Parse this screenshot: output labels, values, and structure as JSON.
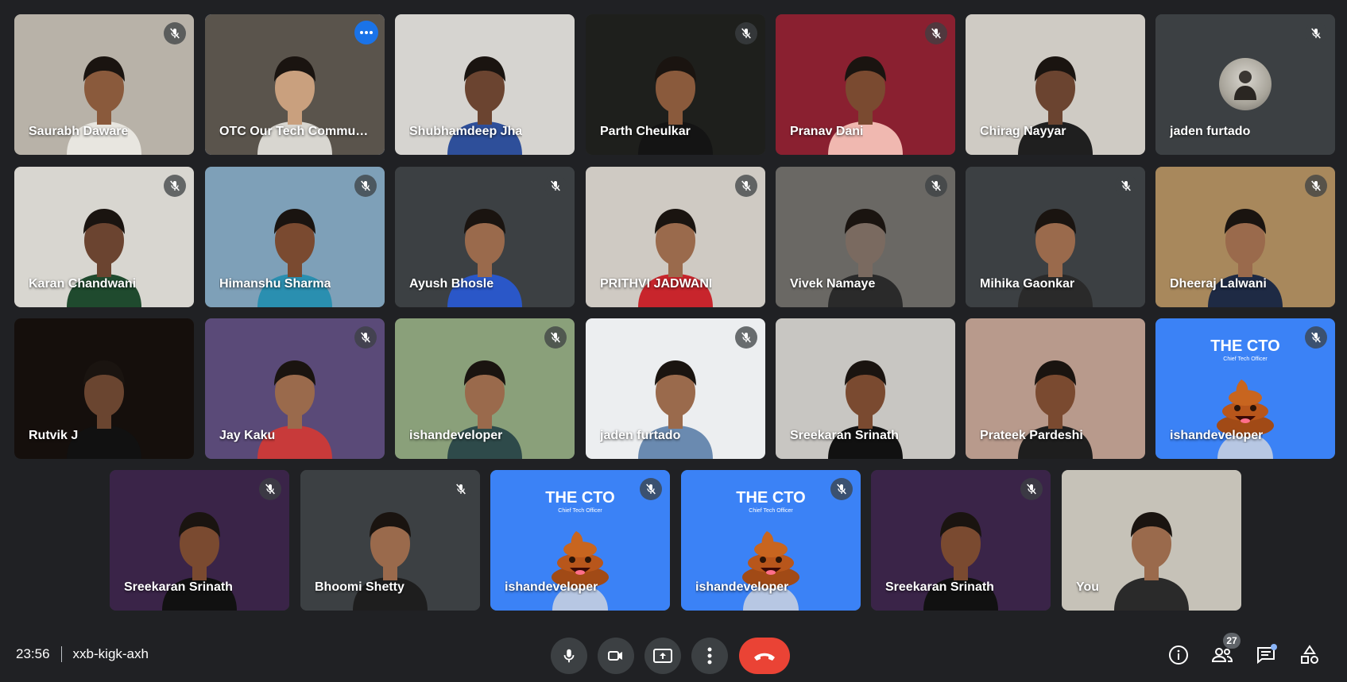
{
  "meeting": {
    "time": "23:56",
    "code": "xxb-kigk-axh"
  },
  "participant_count": "27",
  "colors": {
    "background": "#202124",
    "tile": "#3c4043",
    "accent": "#1a73e8",
    "active_outline": "#8ab4f8",
    "end_call": "#ea4335"
  },
  "cto_card": {
    "title": "THE CTO",
    "subtitle": "Chief Tech Officer"
  },
  "tiles": [
    {
      "name": "Saurabh Daware",
      "muted": true,
      "bg": "#b8b2a8",
      "skin": "#8a5a3c",
      "shirt": "#e8e6e0"
    },
    {
      "name": "OTC Our Tech Community",
      "muted": false,
      "more": true,
      "active": true,
      "bg": "#5a544c",
      "skin": "#c9a07e",
      "shirt": "#d8d6d0"
    },
    {
      "name": "Shubhamdeep Jha",
      "muted": false,
      "bg": "#d6d4d0",
      "skin": "#6b4430",
      "shirt": "#2e4f9a"
    },
    {
      "name": "Parth Cheulkar",
      "muted": true,
      "bg": "#1e1f1c",
      "skin": "#8a5a3c",
      "shirt": "#141414"
    },
    {
      "name": "Pranav Dani",
      "muted": true,
      "bg": "#8a2030",
      "skin": "#7a4a30",
      "shirt": "#f0b8b0"
    },
    {
      "name": "Chirag Nayyar",
      "muted": false,
      "bg": "#cfcbc4",
      "skin": "#6b4430",
      "shirt": "#1f1f1f"
    },
    {
      "name": "jaden furtado",
      "muted": true,
      "avatar": true,
      "bg": "#3c4043"
    },
    {
      "name": "Karan Chandwani",
      "muted": true,
      "bg": "#d8d6d0",
      "skin": "#6b4430",
      "shirt": "#1f4a2e"
    },
    {
      "name": "Himanshu Sharma",
      "muted": true,
      "bg": "#7ea0b8",
      "skin": "#7a4a30",
      "shirt": "#2a8fb0"
    },
    {
      "name": "Ayush Bhosle",
      "muted": true,
      "bg": "#3c4043",
      "skin": "#9a6a4c",
      "shirt": "#2a57c8"
    },
    {
      "name": "PRITHVI JADWANI",
      "muted": true,
      "bg": "#cfcac3",
      "skin": "#9a6a4c",
      "shirt": "#c8252c"
    },
    {
      "name": "Vivek Namaye",
      "muted": true,
      "bg": "#6a6864",
      "skin": "#7a6a60",
      "shirt": "#2a2a2a"
    },
    {
      "name": "Mihika Gaonkar",
      "muted": true,
      "bg": "#3c4043",
      "skin": "#9a6a4c",
      "shirt": "#2a2a2a"
    },
    {
      "name": "Dheeraj Lalwani",
      "muted": true,
      "bg": "#a8885c",
      "skin": "#9a6a4c",
      "shirt": "#1e2a44"
    },
    {
      "name": "Rutvik J",
      "muted": false,
      "bg": "#150f0c",
      "skin": "#6a4530",
      "shirt": "#111111"
    },
    {
      "name": "Jay Kaku",
      "muted": true,
      "bg": "#5a4a78",
      "skin": "#9a6a4c",
      "shirt": "#c83a3a"
    },
    {
      "name": "ishandeveloper",
      "muted": true,
      "bg": "#8aa07a",
      "skin": "#9a6a4c",
      "shirt": "#2e4a4a"
    },
    {
      "name": "jaden furtado",
      "muted": true,
      "bg": "#eceef0",
      "skin": "#9a6a4c",
      "shirt": "#6a8ab0"
    },
    {
      "name": "Sreekaran Srinath",
      "muted": false,
      "bg": "#c8c6c2",
      "skin": "#7a4a30",
      "shirt": "#111111"
    },
    {
      "name": "Prateek Pardeshi",
      "muted": false,
      "bg": "#b89a8c",
      "skin": "#7a4a30",
      "shirt": "#1e1e1e"
    },
    {
      "name": "ishandeveloper",
      "muted": true,
      "cto": true,
      "bg": "#3b82f6"
    },
    {
      "name": "Sreekaran Srinath",
      "muted": true,
      "bg": "#3a2448",
      "skin": "#7a4a30",
      "shirt": "#111111"
    },
    {
      "name": "Bhoomi Shetty",
      "muted": true,
      "bg": "#3c4043",
      "skin": "#9a6a4c",
      "shirt": "#1e1e1e"
    },
    {
      "name": "ishandeveloper",
      "muted": true,
      "cto": true,
      "bg": "#3b82f6"
    },
    {
      "name": "ishandeveloper",
      "muted": true,
      "cto": true,
      "bg": "#3b82f6"
    },
    {
      "name": "Sreekaran Srinath",
      "muted": true,
      "bg": "#3a2448",
      "skin": "#7a4a30",
      "shirt": "#111111"
    },
    {
      "name": "You",
      "muted": false,
      "bg": "#c6c2b8",
      "skin": "#9a6a4c",
      "shirt": "#2a2a2a"
    }
  ],
  "controls": {
    "mic": "microphone-icon",
    "camera": "camera-icon",
    "present": "present-screen-icon",
    "more": "more-options-icon",
    "end": "end-call-icon"
  },
  "right_panel": {
    "info": "info-icon",
    "people": "people-icon",
    "chat": "chat-icon",
    "activities": "activities-icon"
  }
}
